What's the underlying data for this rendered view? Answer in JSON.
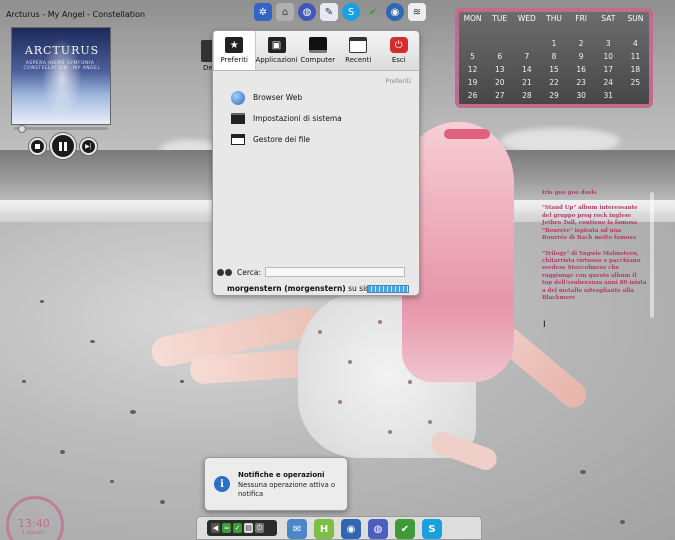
{
  "player": {
    "window_title": "Arcturus - My Angel - Constellation",
    "album_band": "ARCTURUS",
    "album_subtitle": "ASPERA HIEMS SYMFONIA · CONSTELLATION · MY ANGEL",
    "progress": 0.05
  },
  "top_icons": [
    "kde-icon",
    "network-icon",
    "firefox-icon",
    "editor-icon",
    "skype-icon",
    "twitter-icon",
    "globe-icon",
    "hal-icon"
  ],
  "desktop_icon": {
    "label": "De"
  },
  "launcher": {
    "tabs": [
      {
        "id": "preferiti",
        "label": "Preferiti",
        "icon": "star-icon",
        "active": true
      },
      {
        "id": "applicazioni",
        "label": "Applicazioni",
        "icon": "apps-icon"
      },
      {
        "id": "computer",
        "label": "Computer",
        "icon": "computer-icon"
      },
      {
        "id": "recenti",
        "label": "Recenti",
        "icon": "recent-icon"
      },
      {
        "id": "esci",
        "label": "Esci",
        "icon": "power-icon"
      }
    ],
    "section_title": "Preferiti",
    "items": [
      {
        "label": "Browser Web",
        "icon": "globe-icon"
      },
      {
        "label": "Impostazioni di sistema",
        "icon": "settings-icon"
      },
      {
        "label": "Gestore dei file",
        "icon": "file-manager-icon"
      }
    ],
    "search_label": "Cerca:",
    "search_placeholder": "",
    "user_bold": "morgenstern (morgenstern)",
    "user_rest": " su sidi"
  },
  "calendar": {
    "days": [
      "MON",
      "TUE",
      "WED",
      "THU",
      "FRI",
      "SAT",
      "SUN"
    ],
    "weeks": [
      [
        "",
        "",
        "",
        "",
        "",
        "",
        ""
      ],
      [
        "",
        "",
        "",
        "1",
        "2",
        "3",
        "4"
      ],
      [
        "5",
        "6",
        "7",
        "8",
        "9",
        "10",
        "11"
      ],
      [
        "12",
        "13",
        "14",
        "15",
        "16",
        "17",
        "18"
      ],
      [
        "19",
        "20",
        "21",
        "22",
        "23",
        "24",
        "25"
      ],
      [
        "26",
        "27",
        "28",
        "29",
        "30",
        "31",
        ""
      ]
    ]
  },
  "notes": {
    "heading": "Iris goo goo dosls",
    "paragraphs": [
      "\"Stand Up\" album interessante del gruppo prog rock inglese Jethro Tull, contiene la famosa \"Bourrée\" ispirata ad una Bourrée di Bach molto famosa",
      "\"Trilogy\" di Yngwie Malmsteen, chitarrista virtuoso e pacchiano svedese Stoccolmese che raggiunge con questo album il top dell'esuberanza anni 80 mista a del metallo nitragliante alla Blackmore"
    ]
  },
  "notification": {
    "title": "Notifiche e operazioni",
    "body": "Nessuna operazione attiva o notifica"
  },
  "clock": {
    "time": "13:40",
    "sub": "1 Agosto"
  },
  "taskbar": {
    "tray": [
      "volume-icon",
      "network-icon",
      "update-icon",
      "clipboard-icon",
      "power-icon"
    ],
    "apps": [
      {
        "name": "mail-icon",
        "glyph": "✉",
        "color": "#4b86c6"
      },
      {
        "name": "hal-icon",
        "glyph": "H",
        "color": "#7bc043"
      },
      {
        "name": "globe-icon",
        "glyph": "◉",
        "color": "#2f67b3"
      },
      {
        "name": "firefox-icon",
        "glyph": "◍",
        "color": "#4a5fbf"
      },
      {
        "name": "twitter-icon",
        "glyph": "✔",
        "color": "#3f9a3a"
      },
      {
        "name": "skype-icon",
        "glyph": "S",
        "color": "#1a9fe0"
      }
    ]
  },
  "colors": {
    "accent": "#c26b8f",
    "notes_text": "#b23a6b",
    "esci_red": "#d62b2b",
    "info_blue": "#2c6fc4"
  }
}
